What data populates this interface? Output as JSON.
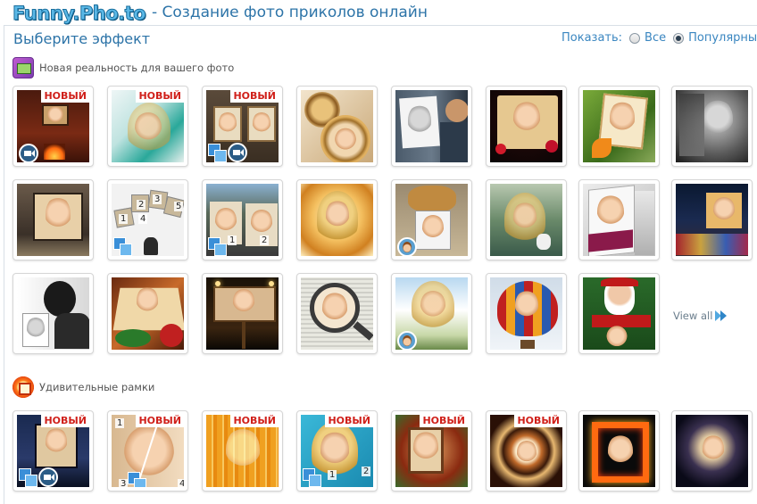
{
  "header": {
    "logo_text": "Funny.Pho.to",
    "title": "- Создание фото приколов онлайн"
  },
  "panel": {
    "title": "Выберите эффект",
    "show_label": "Показать:",
    "filter_options": [
      {
        "label": "Все",
        "selected": false
      },
      {
        "label": "Популярные",
        "selected": true
      }
    ]
  },
  "sections": [
    {
      "title": "Новая реальность для вашего фото",
      "icon": "new-reality-icon"
    },
    {
      "title": "Удивительные рамки",
      "icon": "frame-icon"
    }
  ],
  "badges": {
    "new": "НОВЫЙ"
  },
  "view_all": "View all",
  "numbers": [
    "1",
    "2",
    "3",
    "4",
    "5"
  ],
  "colors": {
    "accent": "#2d74a8",
    "new_badge": "#d0201a",
    "link": "#3a86c0"
  }
}
